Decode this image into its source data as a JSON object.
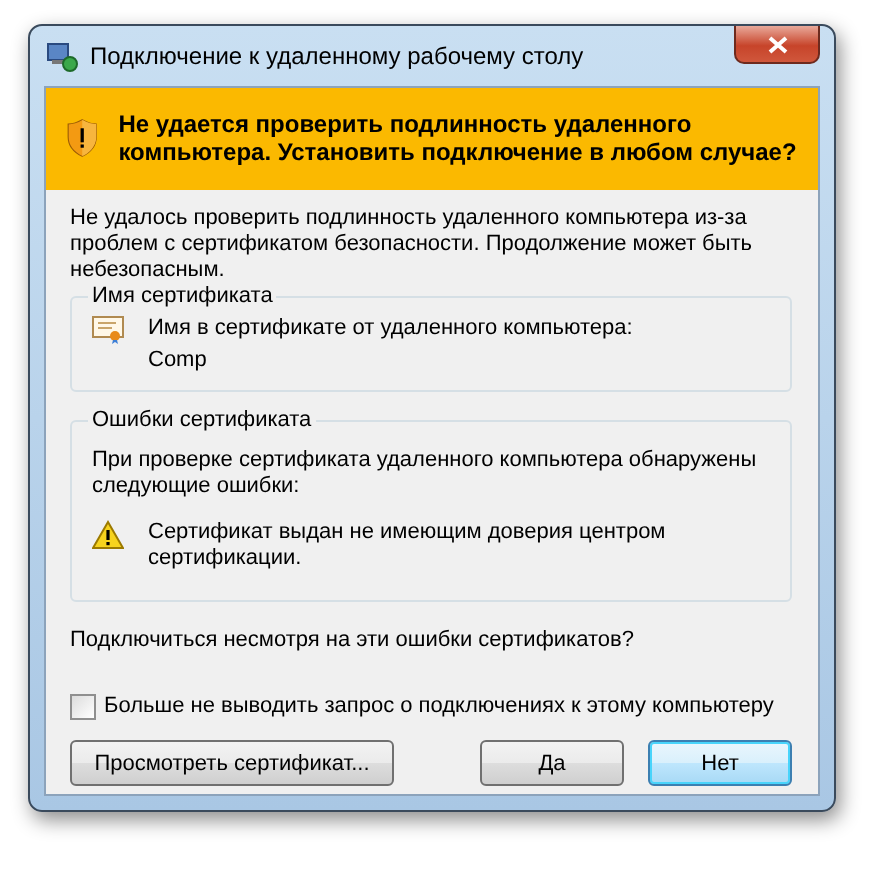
{
  "window": {
    "title": "Подключение к удаленному рабочему столу"
  },
  "banner": {
    "text": "Не удается проверить подлинность удаленного компьютера. Установить подключение в любом случае?"
  },
  "intro": "Не удалось проверить подлинность удаленного компьютера из-за проблем с сертификатом безопасности. Продолжение может быть небезопасным.",
  "certificate_name": {
    "heading": "Имя сертификата",
    "label": "Имя в сертификате от удаленного компьютера:",
    "value": "Comp"
  },
  "certificate_errors": {
    "heading": "Ошибки сертификата",
    "description": "При проверке сертификата удаленного компьютера обнаружены следующие ошибки:",
    "errors": [
      {
        "kind": "warning",
        "text": "Сертификат выдан не имеющим доверия центром сертификации."
      }
    ]
  },
  "question": "Подключиться несмотря на эти ошибки сертификатов?",
  "checkbox": {
    "label": "Больше не выводить запрос о подключениях к этому компьютеру",
    "checked": false
  },
  "buttons": [
    {
      "label": "Просмотреть сертификат...",
      "default": false
    },
    {
      "label": "Да",
      "default": false
    },
    {
      "label": "Нет",
      "default": true
    }
  ]
}
